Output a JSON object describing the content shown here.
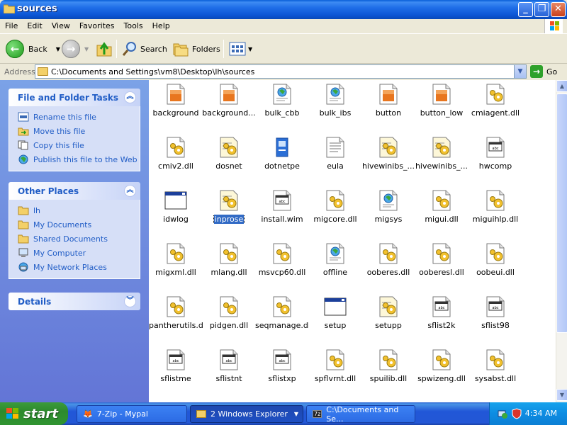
{
  "window": {
    "title": "sources"
  },
  "menu": [
    "File",
    "Edit",
    "View",
    "Favorites",
    "Tools",
    "Help"
  ],
  "toolbar": {
    "back": "Back",
    "search": "Search",
    "folders": "Folders"
  },
  "address": {
    "label": "Address",
    "path": "C:\\Documents and Settings\\vm8\\Desktop\\lh\\sources",
    "go": "Go"
  },
  "tasks": {
    "title": "File and Folder Tasks",
    "items": [
      {
        "label": "Rename this file",
        "icon": "rename-icon"
      },
      {
        "label": "Move this file",
        "icon": "move-icon"
      },
      {
        "label": "Copy this file",
        "icon": "copy-icon"
      },
      {
        "label": "Publish this file to the Web",
        "icon": "web-publish-icon"
      }
    ]
  },
  "other_places": {
    "title": "Other Places",
    "items": [
      {
        "label": "lh",
        "icon": "folder-icon"
      },
      {
        "label": "My Documents",
        "icon": "folder-icon"
      },
      {
        "label": "Shared Documents",
        "icon": "folder-icon"
      },
      {
        "label": "My Computer",
        "icon": "computer-icon"
      },
      {
        "label": "My Network Places",
        "icon": "network-icon"
      }
    ]
  },
  "details": {
    "title": "Details"
  },
  "files": [
    {
      "name": "background",
      "type": "image"
    },
    {
      "name": "background...",
      "type": "image"
    },
    {
      "name": "bulk_cbb",
      "type": "web"
    },
    {
      "name": "bulk_ibs",
      "type": "web"
    },
    {
      "name": "button",
      "type": "image"
    },
    {
      "name": "button_low",
      "type": "image"
    },
    {
      "name": "cmiagent.dll",
      "type": "dll"
    },
    {
      "name": "cmiv2.dll",
      "type": "dll"
    },
    {
      "name": "dosnet",
      "type": "config"
    },
    {
      "name": "dotnetpe",
      "type": "exe"
    },
    {
      "name": "eula",
      "type": "text"
    },
    {
      "name": "hivewinibs_...",
      "type": "config"
    },
    {
      "name": "hivewinibs_...",
      "type": "config"
    },
    {
      "name": "hwcomp",
      "type": "wim"
    },
    {
      "name": "idwlog",
      "type": "window"
    },
    {
      "name": "inprose",
      "type": "config",
      "selected": true
    },
    {
      "name": "install.wim",
      "type": "wim"
    },
    {
      "name": "migcore.dll",
      "type": "dll"
    },
    {
      "name": "migsys",
      "type": "web"
    },
    {
      "name": "migui.dll",
      "type": "dll"
    },
    {
      "name": "miguihlp.dll",
      "type": "dll"
    },
    {
      "name": "migxml.dll",
      "type": "dll"
    },
    {
      "name": "mlang.dll",
      "type": "dll"
    },
    {
      "name": "msvcp60.dll",
      "type": "dll"
    },
    {
      "name": "offline",
      "type": "web"
    },
    {
      "name": "ooberes.dll",
      "type": "dll"
    },
    {
      "name": "ooberesl.dll",
      "type": "dll"
    },
    {
      "name": "oobeui.dll",
      "type": "dll"
    },
    {
      "name": "pantherutils.dll",
      "type": "dll"
    },
    {
      "name": "pidgen.dll",
      "type": "dll"
    },
    {
      "name": "seqmanage.dll",
      "type": "dll"
    },
    {
      "name": "setup",
      "type": "window"
    },
    {
      "name": "setupp",
      "type": "config"
    },
    {
      "name": "sflist2k",
      "type": "wim"
    },
    {
      "name": "sflist98",
      "type": "wim"
    },
    {
      "name": "sflistme",
      "type": "wim"
    },
    {
      "name": "sflistnt",
      "type": "wim"
    },
    {
      "name": "sflistxp",
      "type": "wim"
    },
    {
      "name": "spflvrnt.dll",
      "type": "dll"
    },
    {
      "name": "spuilib.dll",
      "type": "dll"
    },
    {
      "name": "spwizeng.dll",
      "type": "dll"
    },
    {
      "name": "sysabst.dll",
      "type": "dll"
    }
  ],
  "taskbar": {
    "start": "start",
    "buttons": [
      {
        "label": "7-Zip - Mypal",
        "active": false
      },
      {
        "label": "2 Windows Explorer",
        "active": true
      },
      {
        "label": "C:\\Documents and Se...",
        "active": false
      }
    ],
    "clock": "4:34 AM"
  }
}
